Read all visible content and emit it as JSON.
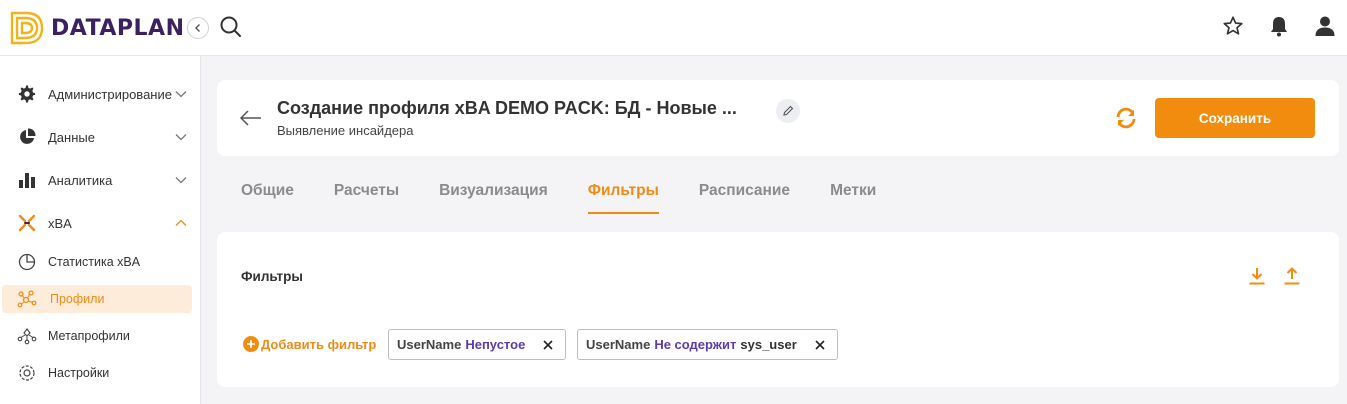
{
  "app": {
    "brand": "DATAPLAN"
  },
  "sidebar": {
    "items": [
      {
        "label": "Администрирование",
        "icon": "gear-icon"
      },
      {
        "label": "Данные",
        "icon": "pie-chart-icon"
      },
      {
        "label": "Аналитика",
        "icon": "bar-chart-icon"
      },
      {
        "label": "xBA",
        "icon": "xba-icon"
      }
    ],
    "sub_items": [
      {
        "label": "Статистика xBA",
        "icon": "pie-outline-icon"
      },
      {
        "label": "Профили",
        "icon": "profiles-icon"
      },
      {
        "label": "Метапрофили",
        "icon": "metaprofiles-icon"
      },
      {
        "label": "Настройки",
        "icon": "settings-icon"
      }
    ]
  },
  "header": {
    "title": "Создание профиля xBA DEMO PACK: БД - Новые ...",
    "subtitle": "Выявление инсайдера",
    "save_label": "Сохранить"
  },
  "tabs": [
    {
      "label": "Общие"
    },
    {
      "label": "Расчеты"
    },
    {
      "label": "Визуализация"
    },
    {
      "label": "Фильтры"
    },
    {
      "label": "Расписание"
    },
    {
      "label": "Метки"
    }
  ],
  "filters": {
    "title": "Фильтры",
    "add_label": "Добавить фильтр",
    "chips": [
      {
        "field": "UserName",
        "operator": "Непустое",
        "value": ""
      },
      {
        "field": "UserName",
        "operator": "Не содержит",
        "value": "sys_user"
      }
    ]
  },
  "colors": {
    "accent": "#f28c0f",
    "brand": "#3b2160",
    "operator": "#5b3bb0"
  }
}
